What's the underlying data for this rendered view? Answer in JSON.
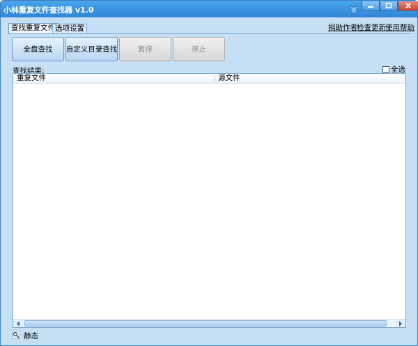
{
  "window": {
    "title": "小林重复文件查找器 v1.0"
  },
  "tabs": [
    {
      "label": "查找重复文件",
      "active": true
    },
    {
      "label": "选项设置",
      "active": false
    }
  ],
  "links": {
    "donate": "捐助作者",
    "update": "检查更新",
    "help": "使用帮助"
  },
  "toolbar": {
    "scan_all": "全盘查找",
    "custom_dir": "自定义目录查找",
    "pause": "暂停",
    "stop": "停止"
  },
  "results": {
    "label": "查找结果:",
    "select_all": "全选",
    "select_all_checked": false,
    "columns": [
      "重复文件",
      "源文件"
    ],
    "rows": []
  },
  "status": {
    "text": "静态"
  },
  "colors": {
    "titlebar": "#3a95e4",
    "background": "#c6dff5",
    "border": "#7aa6cf"
  }
}
